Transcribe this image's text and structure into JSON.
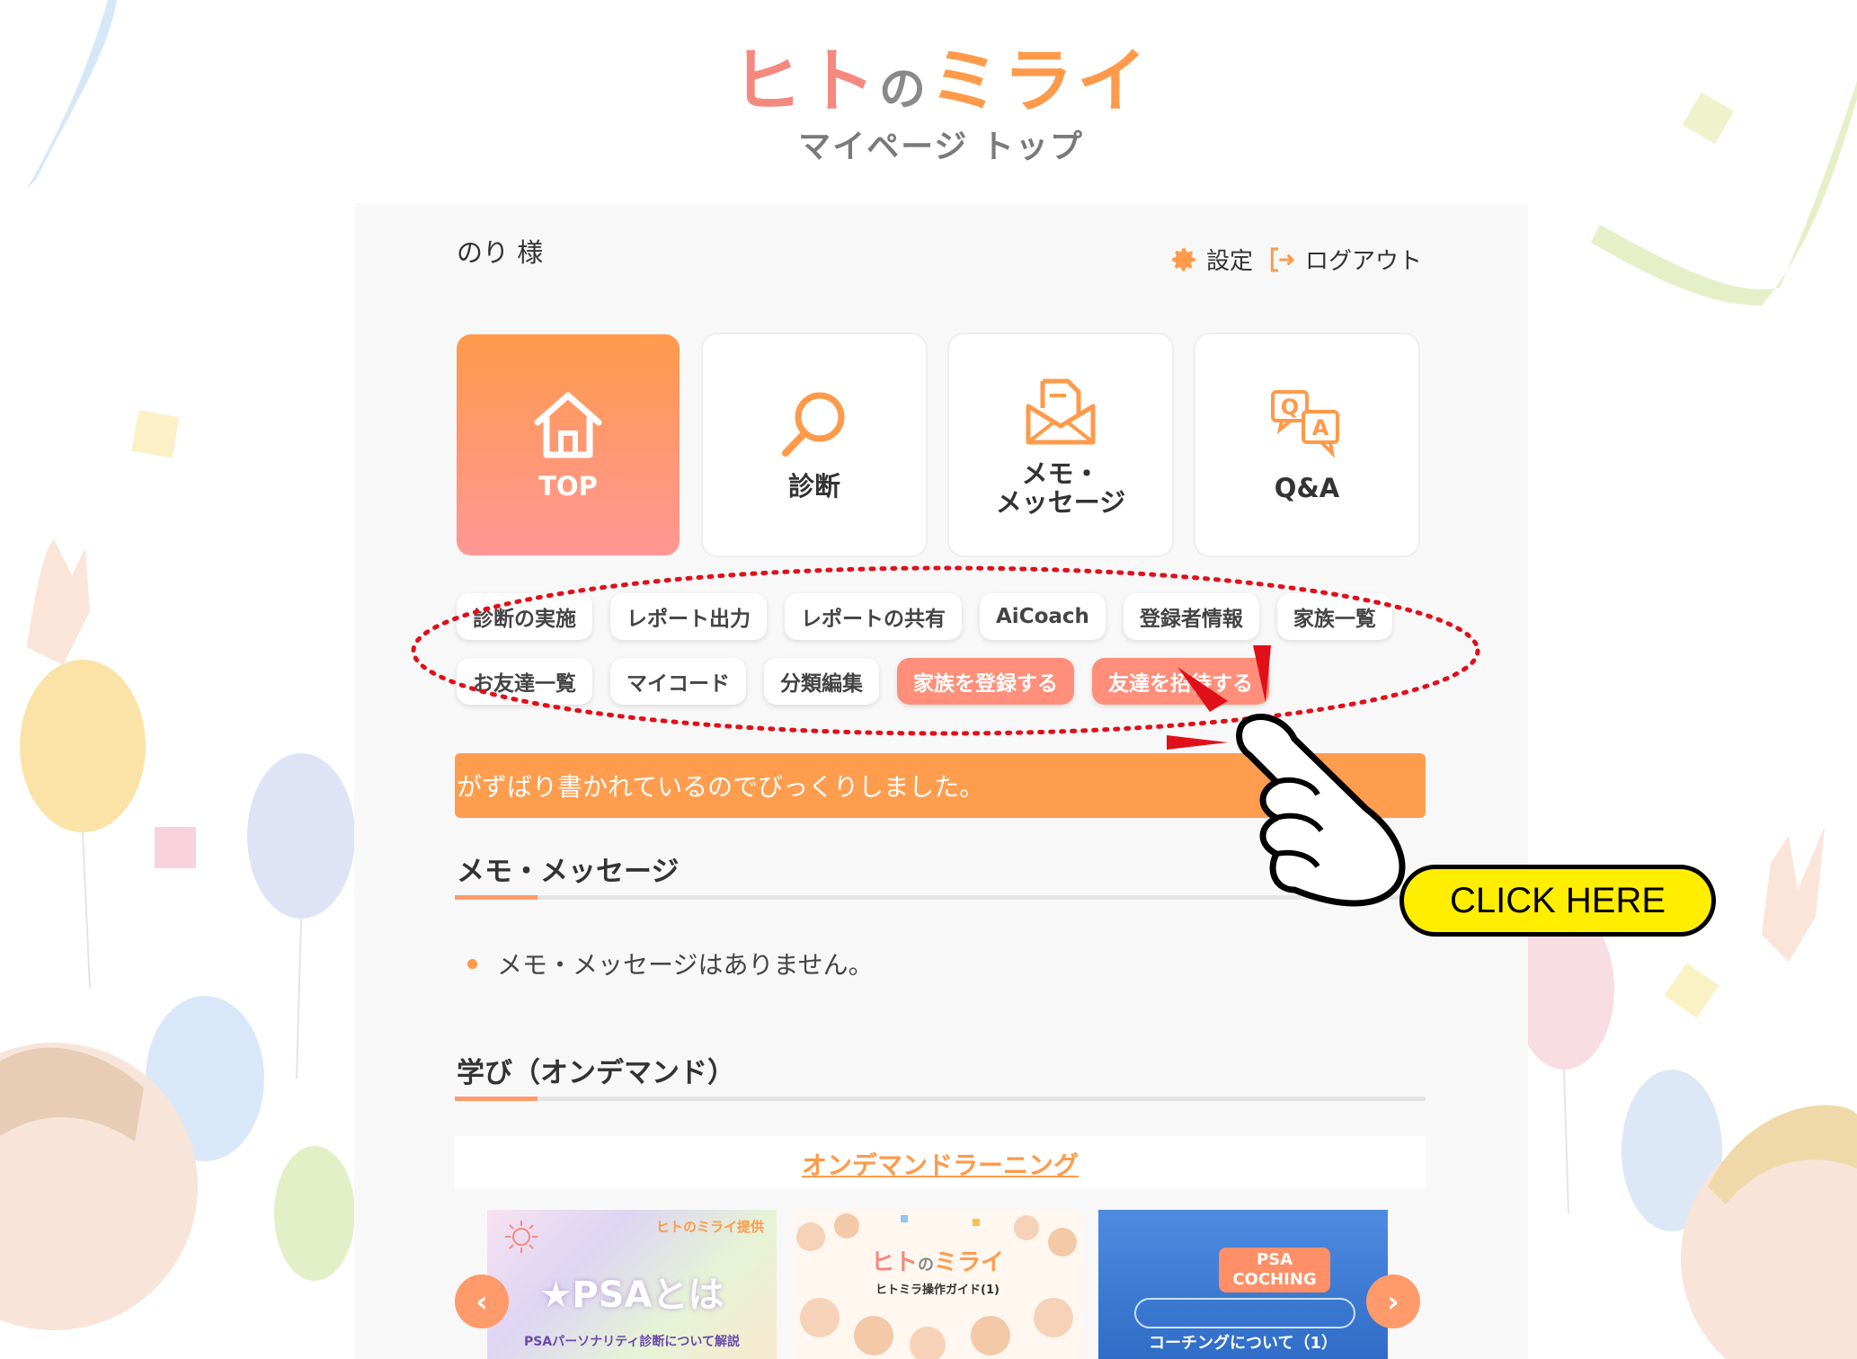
{
  "header": {
    "logo_hito": "ヒト",
    "logo_no": "の",
    "logo_mirai": "ミライ",
    "page_title": "マイページ トップ"
  },
  "user": {
    "name": "のり 様"
  },
  "account_links": {
    "settings": "設定",
    "logout": "ログアウト"
  },
  "nav_tiles": [
    {
      "label": "TOP",
      "icon": "home-icon",
      "active": true
    },
    {
      "label": "診断",
      "icon": "search-icon",
      "active": false
    },
    {
      "label_line1": "メモ・",
      "label_line2": "メッセージ",
      "icon": "mail-icon",
      "active": false
    },
    {
      "label": "Q&A",
      "icon": "qa-icon",
      "active": false
    }
  ],
  "tags": {
    "row1": [
      "診断の実施",
      "レポート出力",
      "レポートの共有",
      "AiCoach",
      "登録者情報",
      "家族一覧"
    ],
    "row2": [
      "お友達一覧",
      "マイコード",
      "分類編集",
      "家族を登録する",
      "友達を招待する"
    ]
  },
  "banner": {
    "text": "がずばり書かれているのでびっくりしました。"
  },
  "memo_section": {
    "title": "メモ・メッセージ",
    "empty_text": "メモ・メッセージはありません。"
  },
  "learning_section": {
    "title": "学び（オンデマンド）",
    "link": "オンデマンドラーニング"
  },
  "cards": [
    {
      "badge": "ヒトのミライ提供",
      "title": "★PSAとは",
      "subtitle": "PSAパーソナリティ診断について解説"
    },
    {
      "title_hito": "ヒト",
      "title_no": "の",
      "title_mirai": "ミライ",
      "subtitle": "ヒトミラ操作ガイド(1)"
    },
    {
      "badge_line1": "PSA",
      "badge_line2": "COCHING",
      "subtitle": "コーチングについて（1）"
    }
  ],
  "carousel": {
    "prev": "‹",
    "next": "›"
  },
  "annotation": {
    "callout": "CLICK HERE"
  },
  "colors": {
    "accent_orange": "#ff9a4a",
    "accent_pink": "#f5887f",
    "hot_tag": "#ff8f7a",
    "annotation_red": "#e0101a"
  }
}
